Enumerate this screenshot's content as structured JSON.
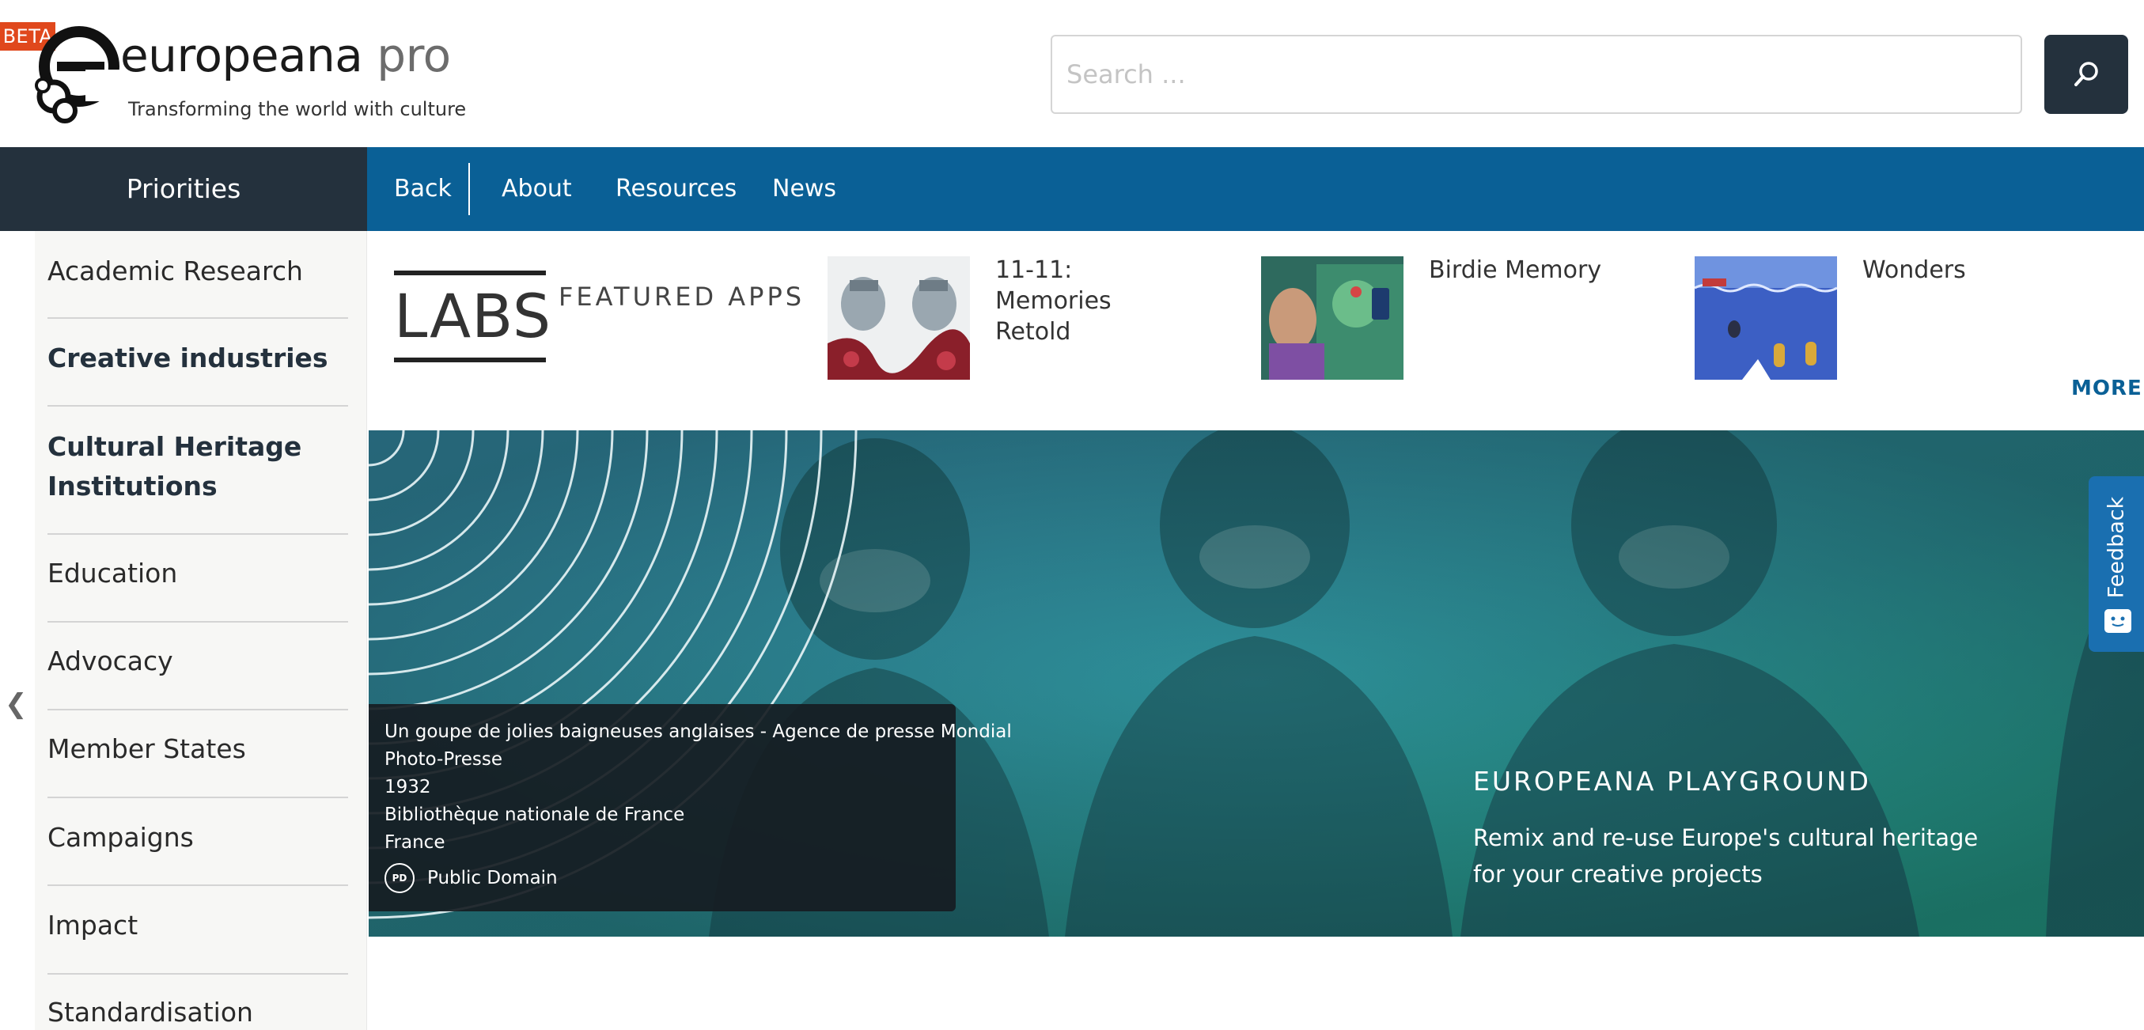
{
  "header": {
    "beta_label": "BETA",
    "brand_main": "europeana",
    "brand_sub": " pro",
    "tagline": "Transforming the world with culture",
    "search": {
      "placeholder": "Search ...",
      "value": ""
    },
    "search_button_icon": "search-icon"
  },
  "nav": {
    "priorities_label": "Priorities",
    "items": [
      {
        "label": "Back"
      },
      {
        "label": "About"
      },
      {
        "label": "Resources"
      },
      {
        "label": "News"
      }
    ]
  },
  "sidebar": {
    "items": [
      {
        "label": "Academic Research",
        "bold": false
      },
      {
        "label": "Creative industries",
        "bold": true
      },
      {
        "label": "Cultural Heritage Institutions",
        "bold": true
      },
      {
        "label": "Education",
        "bold": false
      },
      {
        "label": "Advocacy",
        "bold": false
      },
      {
        "label": "Member States",
        "bold": false
      },
      {
        "label": "Campaigns",
        "bold": false
      },
      {
        "label": "Impact",
        "bold": false
      },
      {
        "label": "Standardisation",
        "bold": false
      }
    ],
    "collapse_icon": "chevron-left-icon",
    "collapse_glyph": "❮"
  },
  "labs": {
    "logo_text": "LABS",
    "featured_label": "FEATURED APPS",
    "apps": [
      {
        "title": "11-11: Memories Retold"
      },
      {
        "title": "Birdie Memory"
      },
      {
        "title": "Wonders"
      }
    ],
    "more_label": "MORE"
  },
  "hero": {
    "caption": {
      "line1": "Un goupe de jolies baigneuses anglaises - Agence de presse Mondial",
      "line2": "Photo-Presse",
      "year": "1932",
      "institution": "Bibliothèque nationale de France",
      "country": "France",
      "license_badge": "PD",
      "license": "Public Domain"
    },
    "title": "EUROPEANA PLAYGROUND",
    "subtitle": "Remix and re-use Europe's cultural heritage for your creative projects"
  },
  "feedback": {
    "label": "Feedback",
    "icon": "chat-icon"
  },
  "colors": {
    "nav_blue": "#0a6096",
    "dark_navy": "#24313d",
    "beta_orange": "#e0481c",
    "hero_teal": "#2a8f96",
    "feedback_blue": "#1a6fb0"
  }
}
